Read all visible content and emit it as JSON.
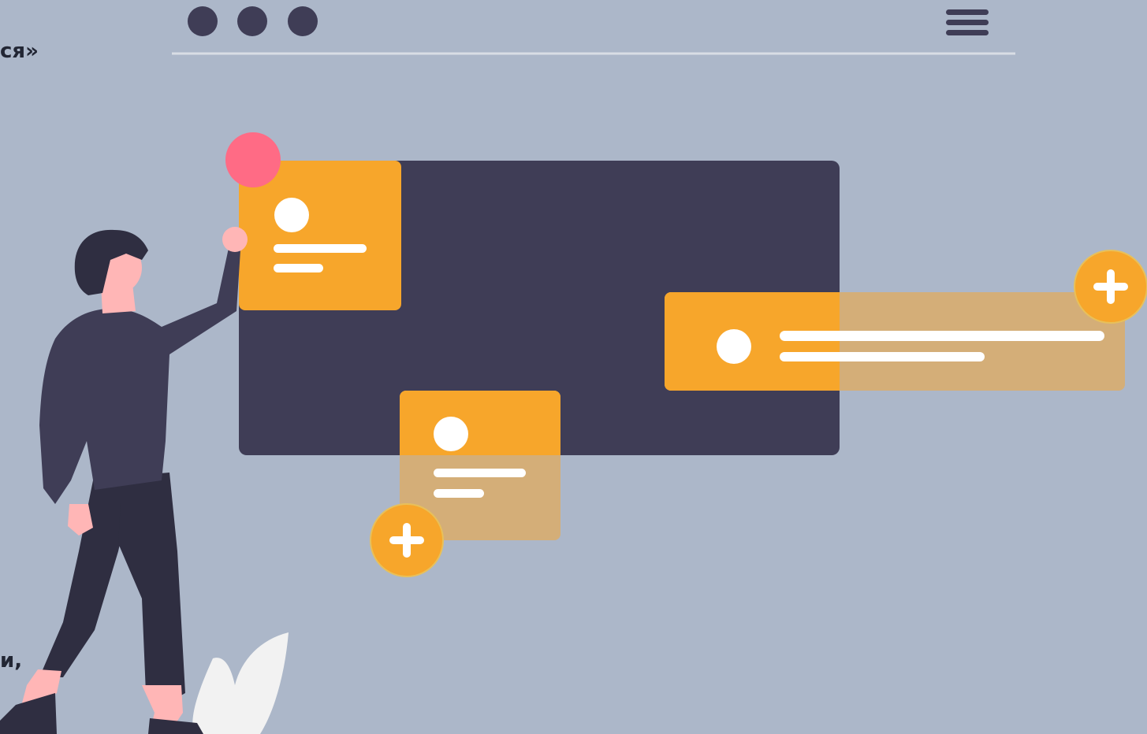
{
  "fragments": {
    "top_text": "ся»",
    "bottom_text": "и,"
  },
  "icons": {
    "window_dots": "window-controls-dots",
    "menu": "hamburger-menu-icon",
    "add": "plus-icon"
  },
  "colors": {
    "background": "#acb7c9",
    "panel": "#3f3d56",
    "card": "#f7a62b",
    "card_faded": "#d4ae78",
    "accent_pink": "#ff6b85",
    "text": "#222634",
    "skin": "#ffb6b6",
    "hair": "#2f2e41"
  }
}
